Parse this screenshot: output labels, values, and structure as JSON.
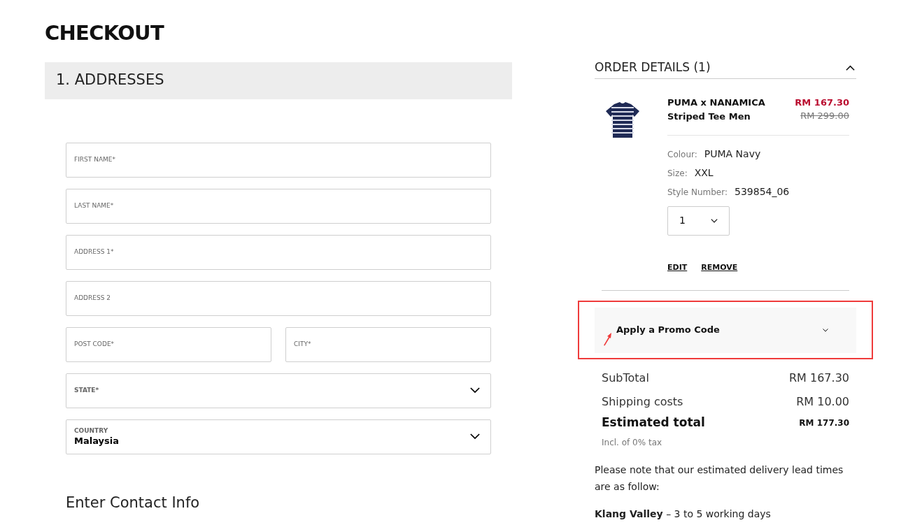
{
  "page_title": "CHECKOUT",
  "section": {
    "title": "1. ADDRESSES"
  },
  "field_rows": [
    [
      {
        "kind": "text",
        "label": "FIRST NAME*"
      }
    ],
    [
      {
        "kind": "text",
        "label": "LAST NAME*"
      }
    ],
    [
      {
        "kind": "text",
        "label": "ADDRESS 1*"
      }
    ],
    [
      {
        "kind": "text",
        "label": "ADDRESS 2"
      }
    ],
    [
      {
        "kind": "text",
        "label": "POST CODE*"
      },
      {
        "kind": "text",
        "label": "CITY*"
      }
    ],
    [
      {
        "kind": "select",
        "label": "STATE*"
      }
    ],
    [
      {
        "kind": "select",
        "label": "COUNTRY",
        "value": "Malaysia"
      }
    ]
  ],
  "contact_heading": "Enter Contact Info",
  "order": {
    "title": "ORDER DETAILS (1)",
    "expanded": true,
    "item": {
      "name": "PUMA x NANAMICA Striped Tee Men",
      "price": "RM 167.30",
      "old_price": "RM 299.00",
      "attributes": [
        {
          "label": "Colour:",
          "value": "PUMA Navy"
        },
        {
          "label": "Size:",
          "value": "XXL"
        },
        {
          "label": "Style Number:",
          "value": "539854_06"
        }
      ],
      "quantity": "1",
      "actions": [
        "EDIT",
        "REMOVE"
      ]
    },
    "promo": {
      "label": "Apply a Promo Code",
      "expanded": false
    },
    "summary": [
      {
        "label": "SubTotal",
        "value": "RM 167.30",
        "kind": "line"
      },
      {
        "label": "Shipping costs",
        "value": "RM 10.00",
        "kind": "line"
      },
      {
        "label": "Estimated total",
        "value": "RM 177.30",
        "kind": "total"
      }
    ],
    "tax_note": "Incl. of 0% tax",
    "delivery_note": "Please note that our estimated delivery lead times are as follow:",
    "delivery_times": [
      "**Klang Valley** – 3 to 5 working days"
    ]
  }
}
